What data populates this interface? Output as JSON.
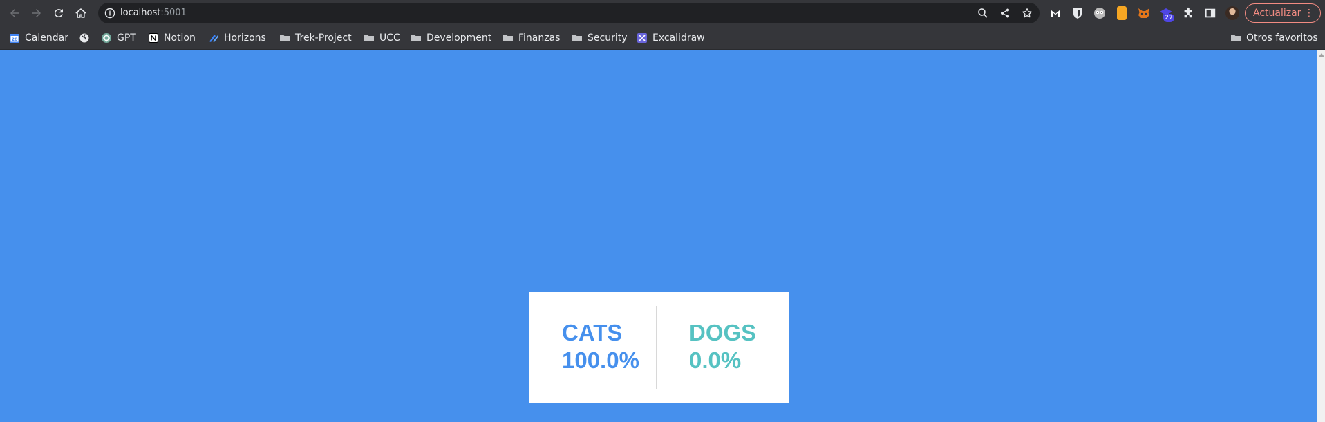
{
  "browser": {
    "url_host": "localhost",
    "url_port": ":5001",
    "update_button_label": "Actualizar",
    "extension_badge_count": "27",
    "bookmarks": [
      {
        "label": "Calendar",
        "icon": "calendar-icon"
      },
      {
        "label": "",
        "icon": "globe-icon"
      },
      {
        "label": "GPT",
        "icon": "openai-icon"
      },
      {
        "label": "Notion",
        "icon": "notion-icon"
      },
      {
        "label": "Horizons",
        "icon": "horizons-icon"
      },
      {
        "label": "Trek-Project",
        "icon": "folder-icon"
      },
      {
        "label": "UCC",
        "icon": "folder-icon"
      },
      {
        "label": "Development",
        "icon": "folder-icon"
      },
      {
        "label": "Finanzas",
        "icon": "folder-icon"
      },
      {
        "label": "Security",
        "icon": "folder-icon"
      },
      {
        "label": "Excalidraw",
        "icon": "excalidraw-icon"
      }
    ],
    "other_bookmarks_label": "Otros favoritos",
    "colors": {
      "chrome": "#35363a",
      "omnibox": "#202124",
      "update_accent": "#f28b82"
    }
  },
  "page": {
    "background_color": "#4690ed",
    "results": {
      "cats": {
        "label": "CATS",
        "percent": "100.0%",
        "color": "#4690ed"
      },
      "dogs": {
        "label": "DOGS",
        "percent": "0.0%",
        "color": "#56c2c2"
      }
    }
  }
}
